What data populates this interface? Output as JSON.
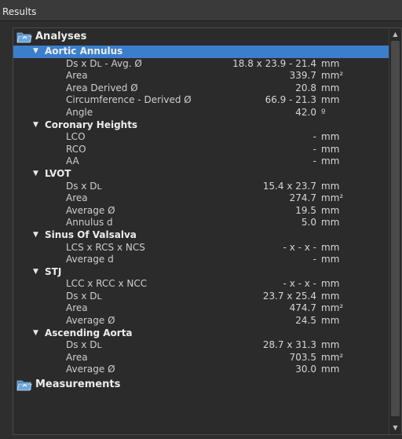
{
  "panel": {
    "title": "Results"
  },
  "tree": {
    "analyses": {
      "label": "Analyses",
      "sections": [
        {
          "label": "Aortic Annulus",
          "items": [
            {
              "label": "Ds x Dʟ - Avg. Ø",
              "value": "18.8 x 23.9 - 21.4",
              "unit": "mm"
            },
            {
              "label": "Area",
              "value": "339.7",
              "unit": "mm²"
            },
            {
              "label": "Area Derived Ø",
              "value": "20.8",
              "unit": "mm"
            },
            {
              "label": "Circumference - Derived Ø",
              "value": "66.9 - 21.3",
              "unit": "mm"
            },
            {
              "label": "Angle",
              "value": "42.0",
              "unit": "º"
            }
          ]
        },
        {
          "label": "Coronary Heights",
          "items": [
            {
              "label": "LCO",
              "value": "-",
              "unit": "mm"
            },
            {
              "label": "RCO",
              "value": "-",
              "unit": "mm"
            },
            {
              "label": "AA",
              "value": "-",
              "unit": "mm"
            }
          ]
        },
        {
          "label": "LVOT",
          "items": [
            {
              "label": "Ds x Dʟ",
              "value": "15.4 x 23.7",
              "unit": "mm"
            },
            {
              "label": "Area",
              "value": "274.7",
              "unit": "mm²"
            },
            {
              "label": "Average Ø",
              "value": "19.5",
              "unit": "mm"
            },
            {
              "label": "Annulus d",
              "value": "5.0",
              "unit": "mm"
            }
          ]
        },
        {
          "label": "Sinus Of Valsalva",
          "items": [
            {
              "label": "LCS x RCS x NCS",
              "value": "- x - x -",
              "unit": "mm"
            },
            {
              "label": "Average d",
              "value": "-",
              "unit": "mm"
            }
          ]
        },
        {
          "label": "STJ",
          "items": [
            {
              "label": "LCC x RCC x NCC",
              "value": "- x - x -",
              "unit": "mm"
            },
            {
              "label": "Ds x Dʟ",
              "value": "23.7 x 25.4",
              "unit": "mm"
            },
            {
              "label": "Area",
              "value": "474.7",
              "unit": "mm²"
            },
            {
              "label": "Average Ø",
              "value": "24.5",
              "unit": "mm"
            }
          ]
        },
        {
          "label": "Ascending Aorta",
          "items": [
            {
              "label": "Ds x Dʟ",
              "value": "28.7 x 31.3",
              "unit": "mm"
            },
            {
              "label": "Area",
              "value": "703.5",
              "unit": "mm²"
            },
            {
              "label": "Average Ø",
              "value": "30.0",
              "unit": "mm"
            }
          ]
        }
      ]
    },
    "measurements": {
      "label": "Measurements"
    },
    "selected_section": "Aortic Annulus"
  },
  "icons": {
    "folder": "folder-open-icon",
    "caret": "caret-down-icon",
    "scroll_up": "scroll-up-icon",
    "scroll_down": "scroll-down-icon"
  },
  "colors": {
    "selection": "#3b7fcc",
    "background": "#2b2b2b",
    "folder": "#5a9ad8"
  }
}
